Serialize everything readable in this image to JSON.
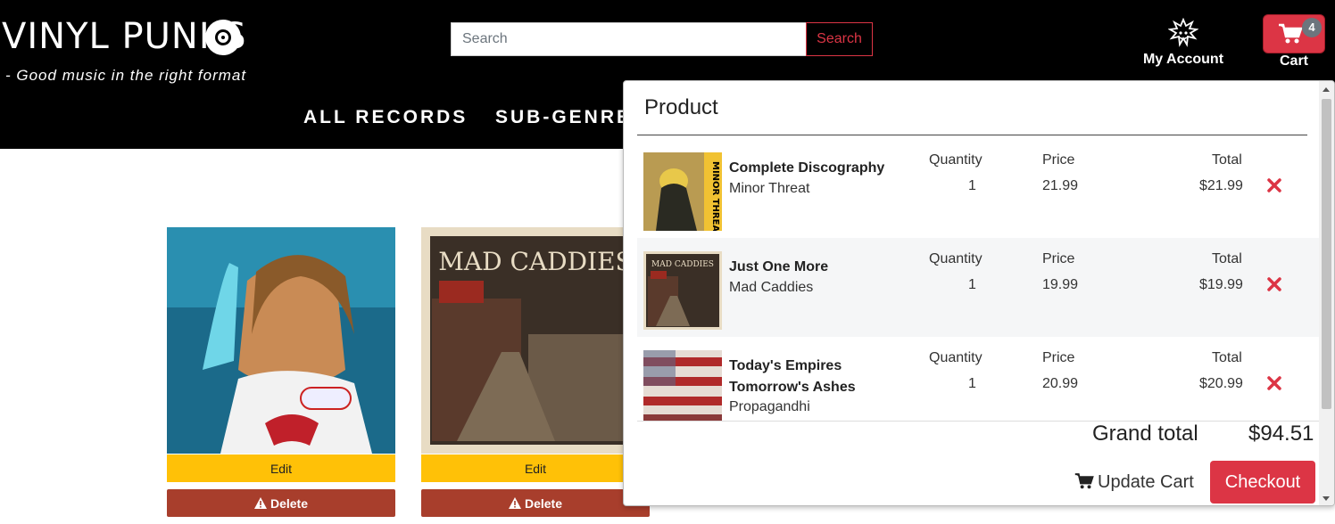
{
  "header": {
    "brand": "VINYL PUNKS",
    "tagline": "- Good music in the right format",
    "nav": [
      "ALL RECORDS",
      "SUB-GENRES"
    ],
    "search": {
      "placeholder": "Search",
      "button": "Search"
    },
    "account_label": "My Account",
    "cart_label": "Cart",
    "cart_count": "4"
  },
  "products": [
    {
      "edit": "Edit",
      "delete": "Delete"
    },
    {
      "edit": "Edit",
      "delete": "Delete"
    }
  ],
  "cart_dropdown": {
    "heading": "Product",
    "col_quantity": "Quantity",
    "col_price": "Price",
    "col_total": "Total",
    "items": [
      {
        "title": "Complete Discography",
        "artist": "Minor Threat",
        "quantity": "1",
        "price": "21.99",
        "total": "$21.99"
      },
      {
        "title": "Just One More",
        "artist": "Mad Caddies",
        "quantity": "1",
        "price": "19.99",
        "total": "$19.99"
      },
      {
        "title": "Today's Empires Tomorrow's Ashes",
        "artist": "Propagandhi",
        "quantity": "1",
        "price": "20.99",
        "total": "$20.99"
      }
    ],
    "grand_total_label": "Grand total",
    "grand_total_value": "$94.51",
    "update_label": "Update Cart",
    "checkout_label": "Checkout"
  },
  "colors": {
    "accent": "#dc3545",
    "edit": "#ffc107",
    "delete": "#a83e2c",
    "header_bg": "#000000"
  },
  "icons": [
    "vinyl-disc-icon",
    "account-icon",
    "cart-icon",
    "warning-icon",
    "remove-icon"
  ]
}
